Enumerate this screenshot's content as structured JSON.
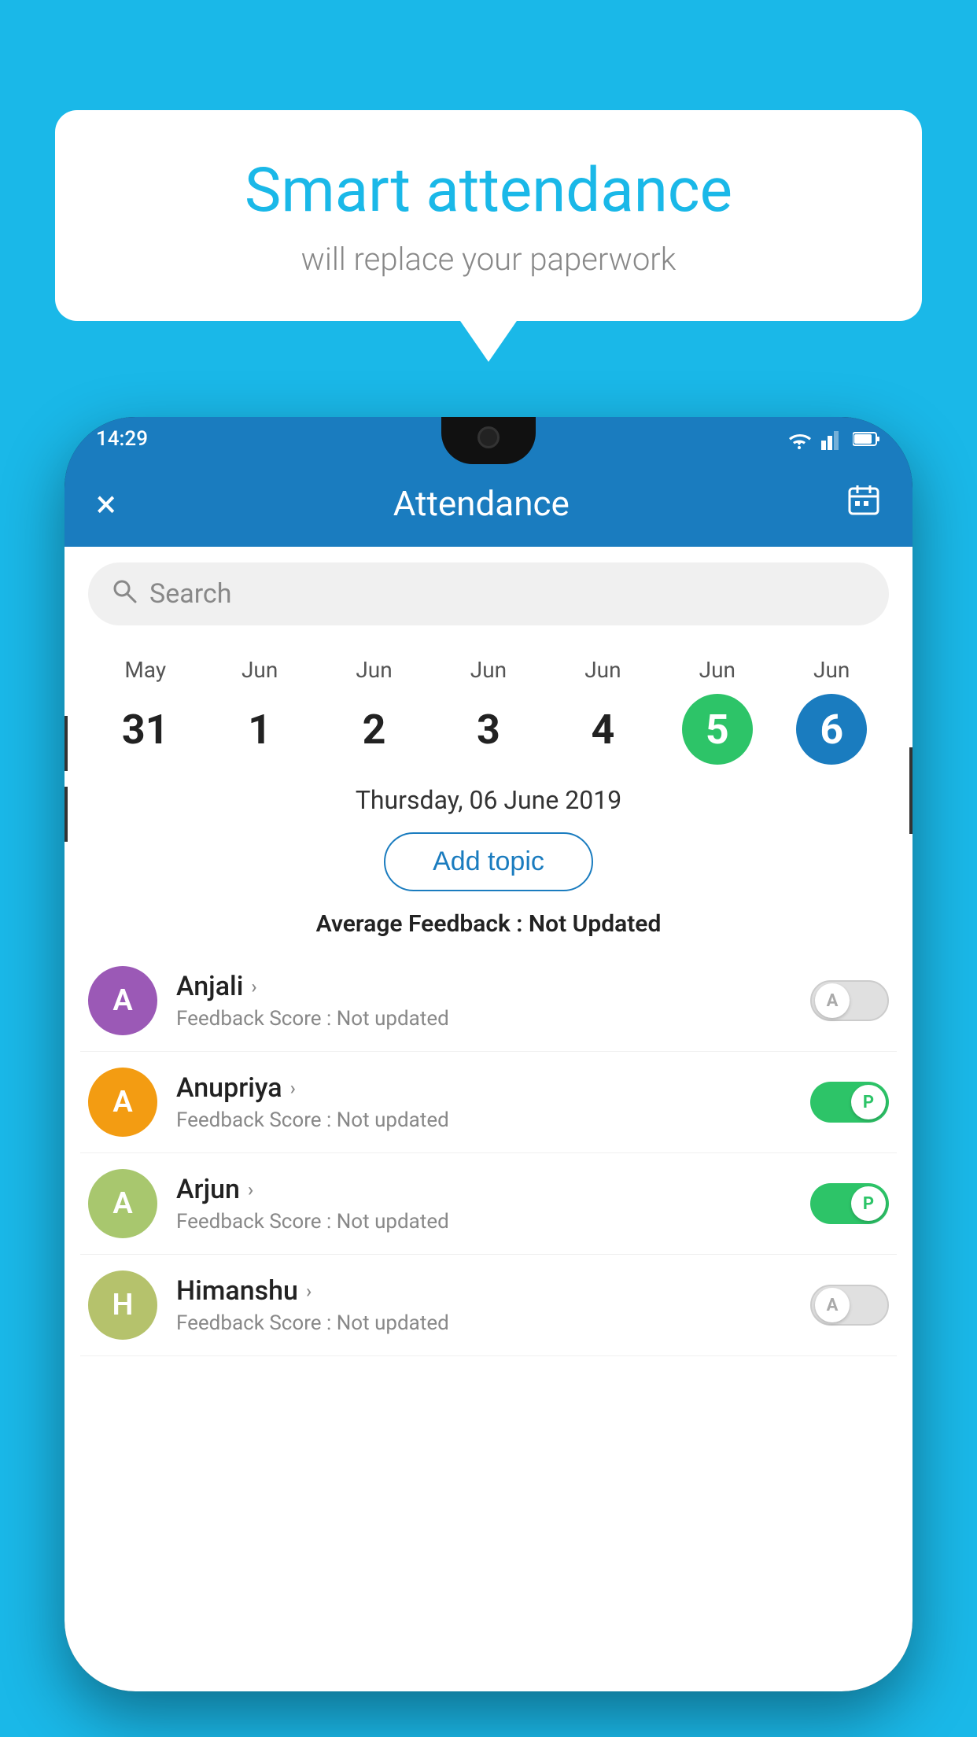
{
  "background_color": "#1ab8e8",
  "speech_bubble": {
    "title": "Smart attendance",
    "subtitle": "will replace your paperwork"
  },
  "phone": {
    "status_bar": {
      "time": "14:29",
      "icons": [
        "wifi",
        "signal",
        "battery"
      ]
    },
    "header": {
      "close_label": "×",
      "title": "Attendance",
      "calendar_icon": "📅"
    },
    "search": {
      "placeholder": "Search"
    },
    "calendar": {
      "days": [
        {
          "month": "May",
          "date": "31",
          "type": "normal"
        },
        {
          "month": "Jun",
          "date": "1",
          "type": "normal"
        },
        {
          "month": "Jun",
          "date": "2",
          "type": "normal"
        },
        {
          "month": "Jun",
          "date": "3",
          "type": "normal"
        },
        {
          "month": "Jun",
          "date": "4",
          "type": "normal"
        },
        {
          "month": "Jun",
          "date": "5",
          "type": "today"
        },
        {
          "month": "Jun",
          "date": "6",
          "type": "selected"
        }
      ]
    },
    "selected_date": "Thursday, 06 June 2019",
    "add_topic_label": "Add topic",
    "avg_feedback_label": "Average Feedback :",
    "avg_feedback_value": "Not Updated",
    "students": [
      {
        "name": "Anjali",
        "avatar_letter": "A",
        "avatar_color": "purple",
        "feedback": "Feedback Score : Not updated",
        "toggle_state": "off",
        "toggle_letter": "A"
      },
      {
        "name": "Anupriya",
        "avatar_letter": "A",
        "avatar_color": "orange",
        "feedback": "Feedback Score : Not updated",
        "toggle_state": "on",
        "toggle_letter": "P"
      },
      {
        "name": "Arjun",
        "avatar_letter": "A",
        "avatar_color": "green",
        "feedback": "Feedback Score : Not updated",
        "toggle_state": "on",
        "toggle_letter": "P"
      },
      {
        "name": "Himanshu",
        "avatar_letter": "H",
        "avatar_color": "olive",
        "feedback": "Feedback Score : Not updated",
        "toggle_state": "off",
        "toggle_letter": "A"
      }
    ]
  }
}
